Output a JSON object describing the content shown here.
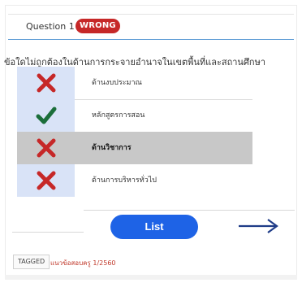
{
  "question": {
    "label": "Question 1",
    "status": "WRONG",
    "text": "ข้อใดไม่ถูกต้องในด้านการกระจายอำนาจในเขตพื้นที่และสถานศึกษา"
  },
  "options": [
    {
      "label": "ด้านงบประมาณ",
      "mark": "cross-icon",
      "selected": false
    },
    {
      "label": "หลักสูตรการสอน",
      "mark": "check-icon",
      "selected": false
    },
    {
      "label": "ด้านวิชาการ",
      "mark": "cross-icon",
      "selected": true
    },
    {
      "label": "ด้านการบริหารทั่วไป",
      "mark": "cross-icon",
      "selected": false
    }
  ],
  "footer": {
    "list_button": "List",
    "next_icon": "arrow-right-icon",
    "tagged_label": "TAGGED",
    "tag": "แนวข้อสอบครู 1/2560"
  },
  "colors": {
    "wrong_badge": "#c62828",
    "cross": "#c62828",
    "check": "#1b6e3a",
    "option_bg": "#d9e3f7",
    "selected_bg": "#c8c8c8",
    "button": "#1e63e6",
    "arrow": "#1f3c88",
    "tag_link": "#c0392b",
    "header_rule": "#5b9bd5"
  }
}
